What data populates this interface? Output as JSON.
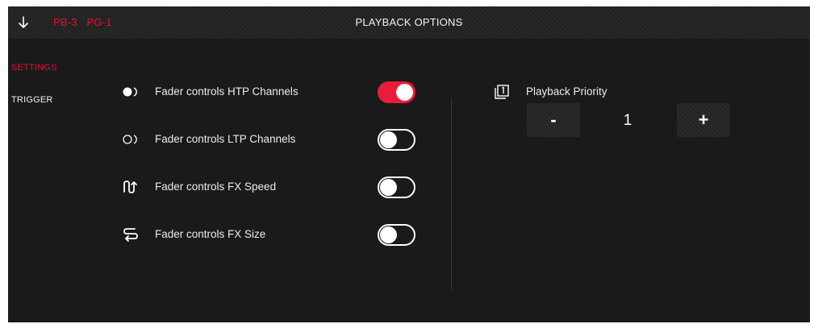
{
  "header": {
    "back_icon": "arrow-down-icon",
    "breadcrumb": [
      "PB-3",
      "PG-1"
    ],
    "title": "PLAYBACK OPTIONS"
  },
  "sidebar": {
    "items": [
      {
        "label": "SETTINGS",
        "active": true
      },
      {
        "label": "TRIGGER",
        "active": false
      }
    ]
  },
  "options": [
    {
      "icon": "filled-circle-icon",
      "label": "Fader controls HTP Channels",
      "enabled": true
    },
    {
      "icon": "outline-circle-icon",
      "label": "Fader controls LTP Channels",
      "enabled": false
    },
    {
      "icon": "fx-speed-icon",
      "label": "Fader controls FX Speed",
      "enabled": false
    },
    {
      "icon": "fx-size-icon",
      "label": "Fader controls FX Size",
      "enabled": false
    }
  ],
  "priority": {
    "icon": "priority-icon",
    "label": "Playback Priority",
    "minus_label": "-",
    "value": "1",
    "plus_label": "+"
  },
  "colors": {
    "accent": "#ea1c3a",
    "background": "#1a1a1a",
    "text": "#ececec"
  }
}
